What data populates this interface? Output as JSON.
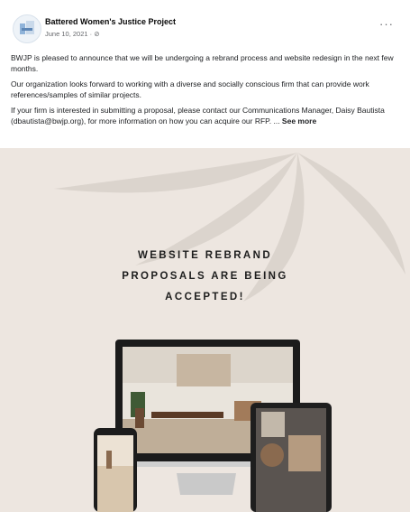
{
  "post": {
    "page_name": "Battered Women's Justice Project",
    "meta": "June 10, 2021 · ⊘",
    "more_label": "···",
    "paragraphs": [
      "BWJP is pleased to announce that we will be undergoing a rebrand process and website redesign in the next few months.",
      "Our organization looks forward to working with a diverse and socially conscious firm that can provide work references/samples of similar projects.",
      "If your firm is interested in submitting a proposal, please contact our Communications Manager, Daisy Bautista (dbautista@bwjp.org), for more information on how you can acquire our RFP. ... "
    ],
    "see_more": "See more"
  },
  "image": {
    "headline_lines": [
      "WEBSITE REBRAND",
      "PROPOSALS ARE BEING",
      "ACCEPTED!"
    ],
    "background": "#ede6e0"
  },
  "colors": {
    "link": "#1c1e21",
    "muted": "#65676b",
    "text": "#1c1e21"
  }
}
